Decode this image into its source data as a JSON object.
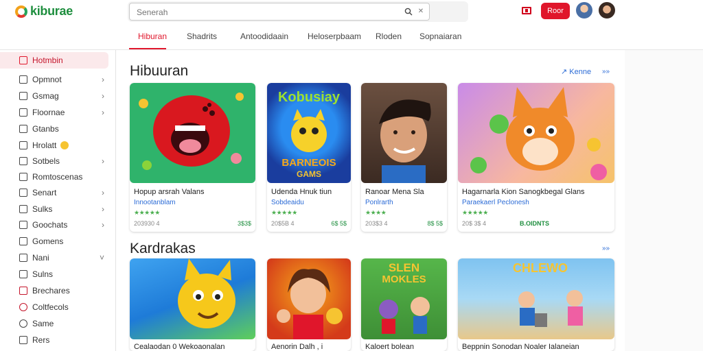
{
  "header": {
    "logo_text": "kiburae",
    "search_placeholder": "Senerah",
    "action_button": "Roor",
    "brand_color": "#e0162b"
  },
  "tabs": [
    {
      "label": "Hiburan",
      "active": true
    },
    {
      "label": "Shadrits"
    },
    {
      "label": "Antoodidaain"
    },
    {
      "label": "Heloserpbaam"
    },
    {
      "label": "Rloden"
    },
    {
      "label": "Sopnaiaran"
    }
  ],
  "sidebar": {
    "items": [
      {
        "label": "Hotmbin",
        "active": true,
        "icon": "app-icon"
      },
      {
        "label": "Opmnot",
        "icon": "doc-icon",
        "chevron": true
      },
      {
        "label": "Gsmag",
        "icon": "game-icon",
        "chevron": true
      },
      {
        "label": "Floornae",
        "icon": "file-icon",
        "chevron": true
      },
      {
        "label": "Gtanbs",
        "icon": "grid-icon"
      },
      {
        "label": "Hrolatt",
        "icon": "bookmark-icon",
        "emoji": true
      },
      {
        "label": "Sotbels",
        "icon": "folder-icon",
        "chevron": true
      },
      {
        "label": "Romtoscenas",
        "icon": "list-icon"
      },
      {
        "label": "Senart",
        "icon": "edit-icon",
        "chevron": true
      },
      {
        "label": "Sulks",
        "icon": "music-icon",
        "chevron": true
      },
      {
        "label": "Goochats",
        "icon": "chat-icon",
        "chevron": true
      },
      {
        "label": "Gomens",
        "icon": "pen-icon"
      },
      {
        "label": "Nani",
        "icon": "book-icon",
        "chevron": true
      },
      {
        "label": "Sulns",
        "icon": "star-icon"
      },
      {
        "label": "Brechares",
        "icon": "share-icon"
      },
      {
        "label": "Coltfecols",
        "icon": "heart-icon"
      },
      {
        "label": "Same",
        "icon": "search-icon"
      },
      {
        "label": "Rers",
        "icon": "user-icon"
      }
    ]
  },
  "sections": [
    {
      "title": "Hibuuran",
      "more_label": "Kenne",
      "more_arrow": "»»",
      "cards": [
        {
          "title": "Hopup arsrah Valans",
          "subtitle": "Innootanblam",
          "stars": "★★★★★",
          "meta": "203930 4",
          "price": "3$3$",
          "art_text": ""
        },
        {
          "title": "Udenda Hnuk tiun",
          "subtitle": "Sobdeaidu",
          "stars": "★★★★★",
          "meta": "20$5B 4",
          "price": "6$ 5$",
          "art_text": "Kobusiay",
          "art_text2": "BARNEOIS",
          "art_text3": "GAMS"
        },
        {
          "title": "Ranoar Mena Sla",
          "subtitle": "Ponlrarth",
          "stars": "★★★★",
          "meta": "203$3 4",
          "price": "8$ 5$",
          "art_text": ""
        },
        {
          "title": "Hagarnarla Kion Sanogkbegal Glans",
          "subtitle": "Paraekaerl Peclonesh",
          "stars": "★★★★★",
          "meta": "20$ 3$ 4",
          "price": "B.OIDNTS",
          "art_text": ""
        }
      ]
    },
    {
      "title": "Kardrakas",
      "more_label": "",
      "more_arrow": "»»",
      "cards": [
        {
          "title": "Cealaodan 0 Wekoaonalan"
        },
        {
          "title": "Aenorin Dalh , i"
        },
        {
          "title": "Kaloert bolean",
          "art_text": "SLEN",
          "art_text2": "MOKLES"
        },
        {
          "title": "Beppnin Sonodan Noaler Ialaneian",
          "art_text": "CHLEWO"
        }
      ]
    }
  ],
  "icons": [
    "search-icon",
    "close-icon",
    "flag-icon",
    "chevron-right-icon",
    "chevron-down-icon",
    "star-icon"
  ]
}
